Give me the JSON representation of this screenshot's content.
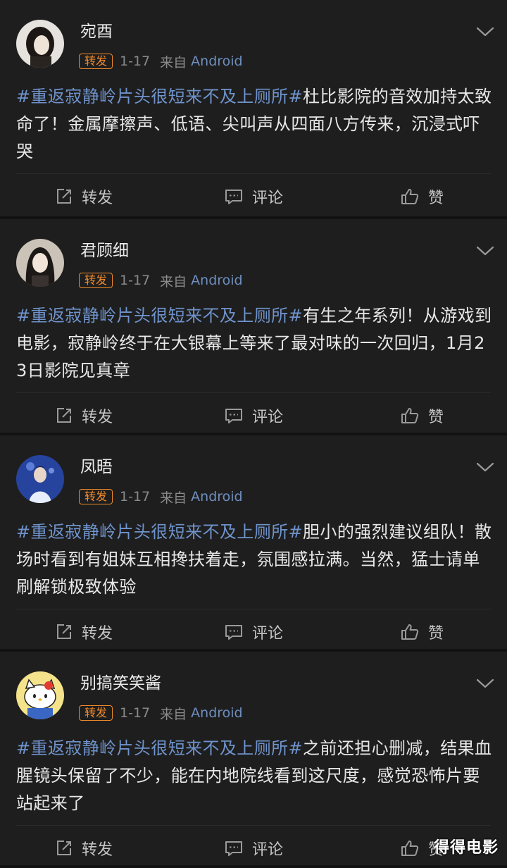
{
  "posts": [
    {
      "username": "宛酉",
      "badge": "转发",
      "date": "1-17",
      "source_prefix": "来自",
      "source_name": "Android",
      "hashtag": "#重返寂静岭片头很短来不及上厕所#",
      "text": "杜比影院的音效加持太致命了！金属摩擦声、低语、尖叫声从四面八方传来，沉浸式吓哭",
      "actions": {
        "repost": "转发",
        "comment": "评论",
        "like": "赞"
      },
      "avatar_icon": "avatar-woman-dark-hair",
      "avatar_colors": [
        "#e9e4df",
        "#2a2420"
      ]
    },
    {
      "username": "君顾细",
      "badge": "转发",
      "date": "1-17",
      "source_prefix": "来自",
      "source_name": "Android",
      "hashtag": "#重返寂静岭片头很短来不及上厕所#",
      "text": "有生之年系列！从游戏到电影，寂静岭终于在大银幕上等来了最对味的一次回归，1月23日影院见真章",
      "actions": {
        "repost": "转发",
        "comment": "评论",
        "like": "赞"
      },
      "avatar_icon": "avatar-woman-long-hair",
      "avatar_colors": [
        "#cfc6bd",
        "#1c1816"
      ]
    },
    {
      "username": "凤晤",
      "badge": "转发",
      "date": "1-17",
      "source_prefix": "来自",
      "source_name": "Android",
      "hashtag": "#重返寂静岭片头很短来不及上厕所#",
      "text": "胆小的强烈建议组队！散场时看到有姐妹互相搀扶着走，氛围感拉满。当然，猛士请单刷解锁极致体验",
      "actions": {
        "repost": "转发",
        "comment": "评论",
        "like": "赞"
      },
      "avatar_icon": "avatar-performer-blue-stage",
      "avatar_colors": [
        "#2a4aa8",
        "#e8eefc"
      ]
    },
    {
      "username": "别搞笑笑酱",
      "badge": "转发",
      "date": "1-17",
      "source_prefix": "来自",
      "source_name": "Android",
      "hashtag": "#重返寂静岭片头很短来不及上厕所#",
      "text": "之前还担心删减，结果血腥镜头保留了不少，能在内地院线看到这尺度，感觉恐怖片要站起来了",
      "actions": {
        "repost": "转发",
        "comment": "评论",
        "like": "赞"
      },
      "avatar_icon": "avatar-hello-kitty",
      "avatar_colors": [
        "#ffffff",
        "#e23a2f"
      ]
    }
  ],
  "icons": {
    "more": "chevron-down-icon",
    "repost": "repost-icon",
    "comment": "comment-icon",
    "like": "thumbs-up-icon"
  },
  "colors": {
    "background": "#1e1e1e",
    "separator": "#121212",
    "hashtag": "#6f93cc",
    "badge": "#f08a2c",
    "source": "#6f8fbf"
  },
  "watermark": "得得电影"
}
